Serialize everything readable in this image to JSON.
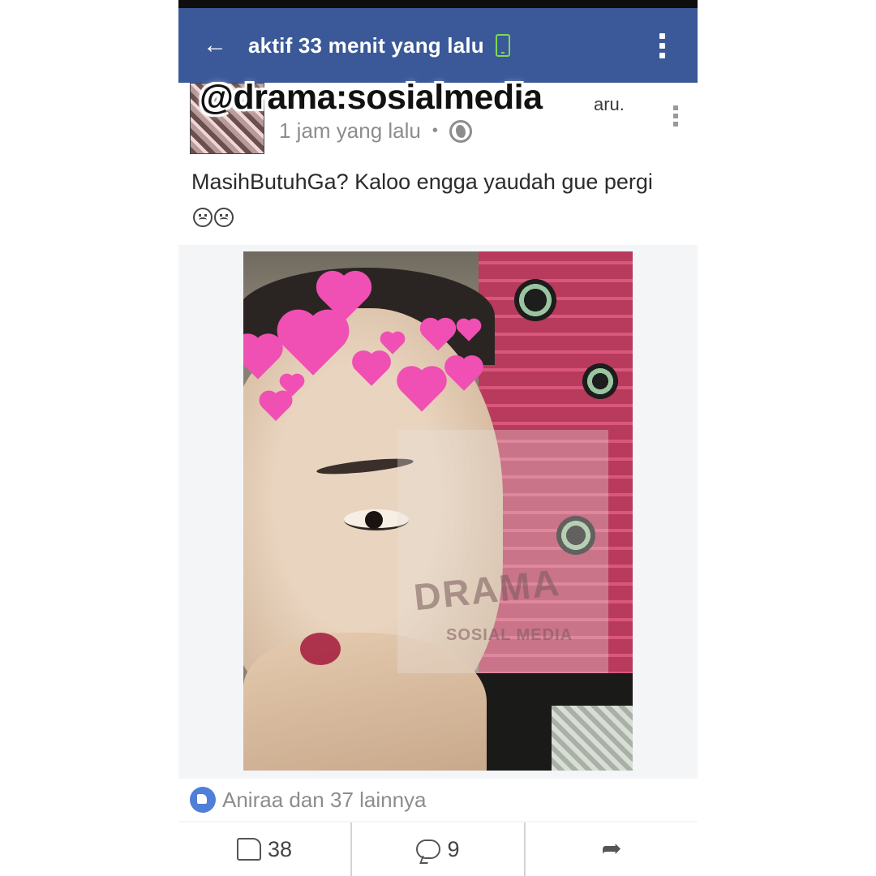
{
  "topbar": {
    "title": "aktif 33 menit yang lalu"
  },
  "post": {
    "author_tail": "aru.",
    "time": "1 jam yang lalu",
    "separator": "•",
    "text": "MasihButuhGa? Kaloo engga yaudah gue pergi",
    "emojis": "😢😐"
  },
  "watermarks": {
    "handle": "@drama:sosialmedia",
    "logo_title": "DRAMA",
    "logo_subtitle": "SOSIAL MEDIA"
  },
  "reactions": {
    "summary": "Aniraa dan 37 lainnya"
  },
  "actions": {
    "like_count": "38",
    "comment_count": "9"
  },
  "colors": {
    "header_blue": "#3b5998",
    "online_green": "#7cd957",
    "like_blue": "#4f7fd8"
  },
  "icons": [
    "back-arrow-icon",
    "phone-icon",
    "menu-icon",
    "globe-icon",
    "post-menu-icon",
    "like-badge-icon",
    "like-icon",
    "comment-icon",
    "share-icon"
  ]
}
